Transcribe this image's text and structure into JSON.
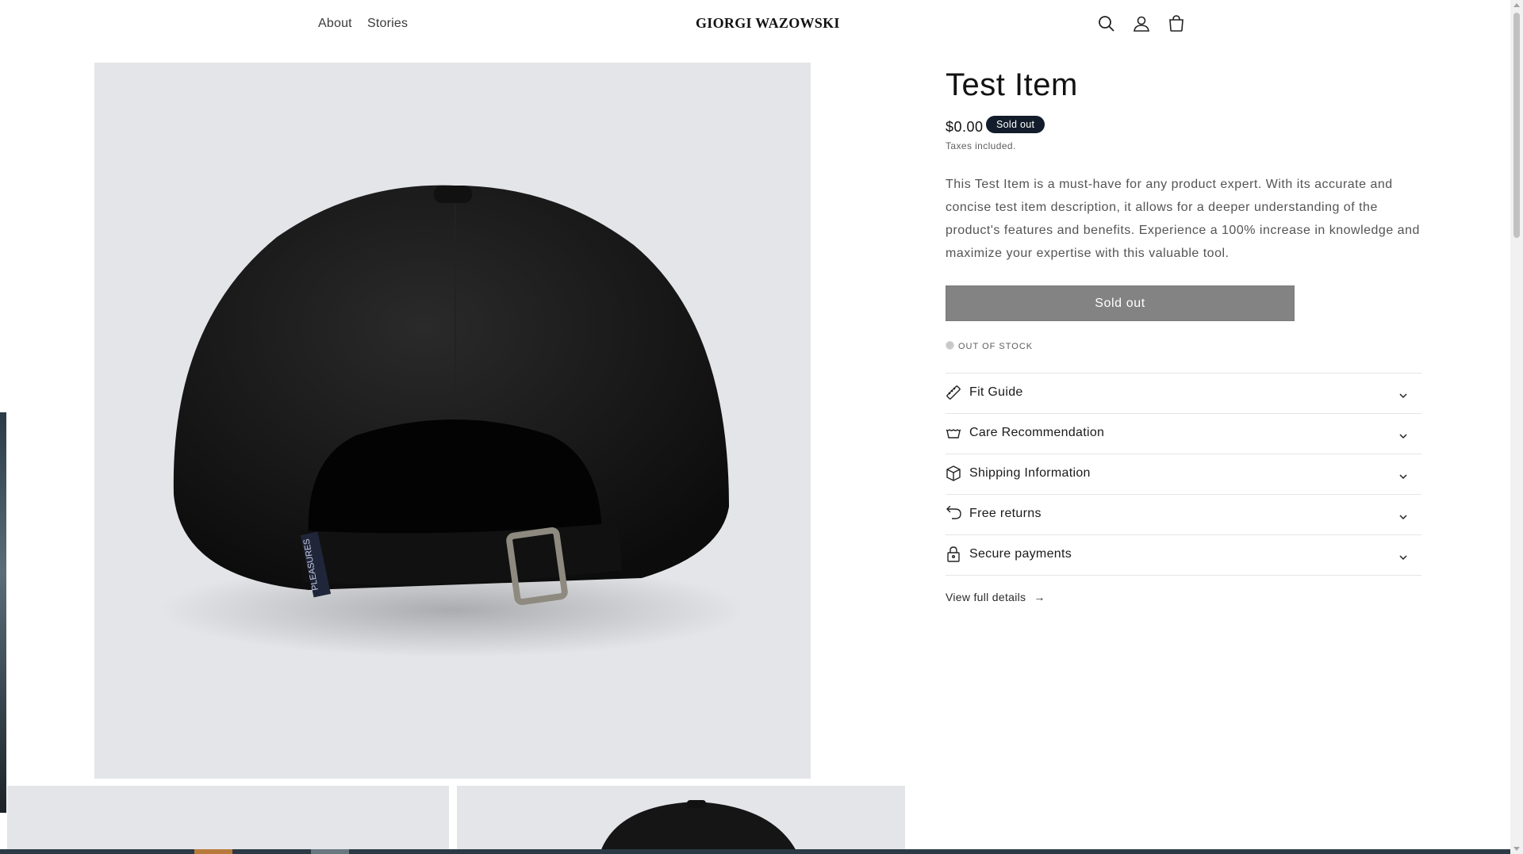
{
  "header": {
    "nav": [
      {
        "label": "About"
      },
      {
        "label": "Stories"
      }
    ],
    "logo": "GIORGI WAZOWSKI",
    "icons": [
      "search-icon",
      "account-icon",
      "cart-icon"
    ]
  },
  "product": {
    "title": "Test Item",
    "price": "$0.00",
    "badge": "Sold out",
    "taxes_note": "Taxes included.",
    "description": "This Test Item is a must-have for any product expert. With its accurate and concise test item description, it allows for a deeper understanding of the product's features and benefits. Experience a 100% increase in knowledge and maximize your expertise with this valuable tool.",
    "buy_button": "Sold out",
    "stock_status": "OUT OF STOCK",
    "accordion": [
      {
        "label": "Fit Guide",
        "icon": "ruler-icon"
      },
      {
        "label": "Care Recommendation",
        "icon": "washing-icon"
      },
      {
        "label": "Shipping Information",
        "icon": "box-icon"
      },
      {
        "label": "Free returns",
        "icon": "return-arrow-icon"
      },
      {
        "label": "Secure payments",
        "icon": "lock-icon"
      }
    ],
    "view_details": "View full details"
  },
  "colors": {
    "badge_bg": "#121c2a",
    "button_bg": "#838383",
    "image_bg": "#e4e5e9"
  }
}
